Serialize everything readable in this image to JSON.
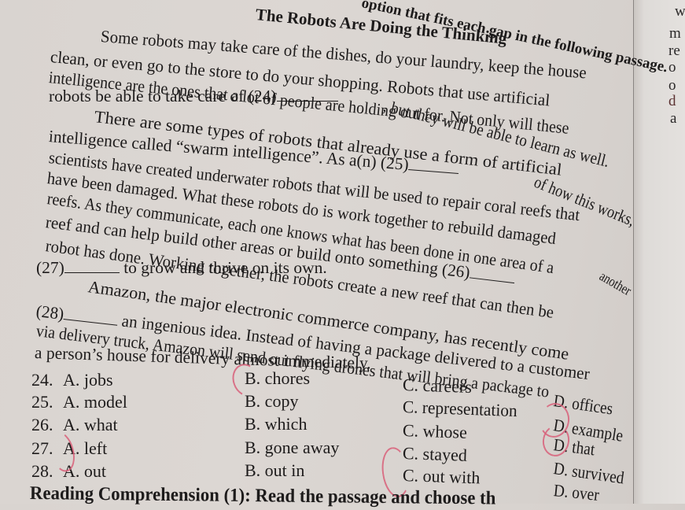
{
  "instruction_fragment": "option that fits each gap in the following passage.",
  "title": "The Robots Are Doing the Thinking",
  "passage": {
    "lines": [
      "Some robots may take care of the dishes, do your laundry, keep the house",
      "clean, or even go to the store to do your shopping. Robots that use artificial",
      "intelligence are the ones that a lot of people are holding out for. Not only will these",
      "robots be able to take care of (24)",
      ", but they will be able to learn as well.",
      "There are some types of robots that already use a form of artificial",
      "intelligence called “swarm intelligence”. As a(n) (25)",
      "of how this works,",
      "scientists have created underwater robots that will be used to repair coral reefs that",
      "have been damaged. What these robots do is work together to rebuild damaged",
      "reefs. As they communicate, each one knows what has been done in one area of a",
      "reef and can help build other areas or build onto something (26)",
      "another",
      "robot has done. Working together, the robots create a new reef that can then be",
      "(27)",
      "to grow and thrive on its own.",
      "Amazon, the major electronic commerce company, has recently come",
      "(28)",
      "an ingenious idea. Instead of having a package delivered to a customer",
      "via delivery truck, Amazon will send out flying drones that will bring a package to",
      "a person’s house for delivery almost immediately."
    ]
  },
  "questions": [
    {
      "number": "24.",
      "options": [
        "A. jobs",
        "B. chores",
        "C. careers",
        "D. offices"
      ],
      "marked": "B"
    },
    {
      "number": "25.",
      "options": [
        "A. model",
        "B. copy",
        "C. representation",
        "D. example"
      ],
      "marked": "D"
    },
    {
      "number": "26.",
      "options": [
        "A. what",
        "B. which",
        "C. whose",
        "D. that"
      ],
      "marked": "D"
    },
    {
      "number": "27.",
      "options": [
        "A. left",
        "B. gone away",
        "C. stayed",
        "D. survived"
      ],
      "marked": "A"
    },
    {
      "number": "28.",
      "options": [
        "A. out",
        "B. out in",
        "C. out with",
        "D. over"
      ],
      "marked": "C"
    }
  ],
  "next_section_heading": "Reading Comprehension (1): Read the passage and choose th",
  "right_page_fragments": [
    "w",
    "m",
    "re",
    "o",
    "o",
    "d",
    "a"
  ],
  "colors": {
    "paper": "#dcd7d3",
    "ink": "#1d1b1b",
    "pen_mark": "#d9607a"
  }
}
